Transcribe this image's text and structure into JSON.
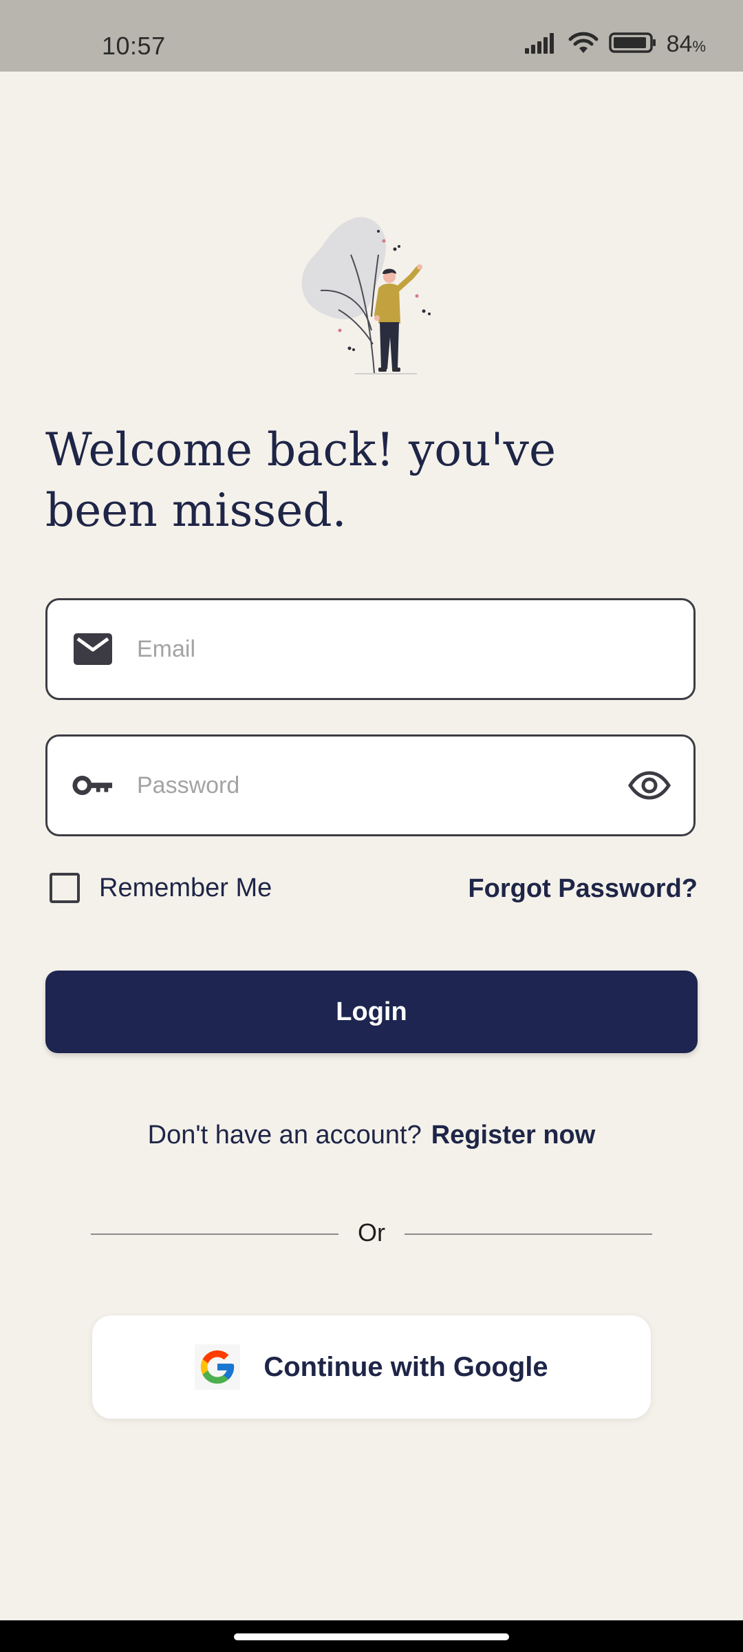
{
  "status_bar": {
    "time": "10:57",
    "battery_percent": "84",
    "battery_unit": "%"
  },
  "heading": "Welcome back! you've been missed.",
  "email_field": {
    "placeholder": "Email",
    "value": "",
    "icon": "mail-icon"
  },
  "password_field": {
    "placeholder": "Password",
    "value": "",
    "icon": "key-icon",
    "toggle_icon": "eye-icon"
  },
  "remember_me": {
    "label": "Remember Me",
    "checked": false
  },
  "forgot_password": "Forgot Password?",
  "login_button": "Login",
  "register": {
    "prompt": "Don't have an account?",
    "link": "Register now"
  },
  "divider_text": "Or",
  "google_button": {
    "label": "Continue with Google",
    "icon": "google-logo-icon"
  },
  "colors": {
    "background": "#f4f1ea",
    "primary": "#1d2550",
    "status_bar": "#b8b5ae",
    "text": "#1e2547"
  }
}
